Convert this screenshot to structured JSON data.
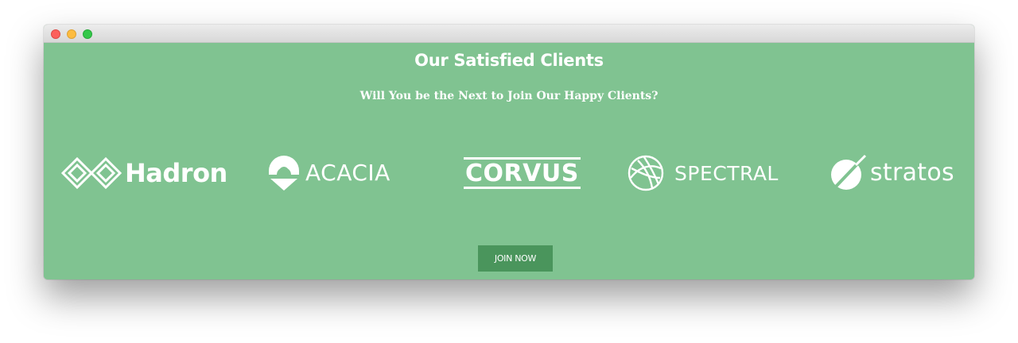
{
  "window": {
    "controls": [
      "close",
      "minimize",
      "maximize"
    ]
  },
  "section": {
    "title": "Our Satisfied Clients",
    "subtitle": "Will You be the Next to Join Our Happy Clients?"
  },
  "clients": [
    {
      "name": "Hadron",
      "icon": "hadron-logo-icon"
    },
    {
      "name": "ACACIA",
      "icon": "acacia-logo-icon"
    },
    {
      "name": "CORVUS",
      "icon": "corvus-logo"
    },
    {
      "name": "SPECTRAL",
      "icon": "spectral-logo-icon"
    },
    {
      "name": "stratos",
      "icon": "stratos-logo-icon"
    }
  ],
  "cta": {
    "label": "JOIN NOW"
  },
  "colors": {
    "background": "#80c391",
    "button": "#4a955c",
    "text": "#ffffff"
  }
}
